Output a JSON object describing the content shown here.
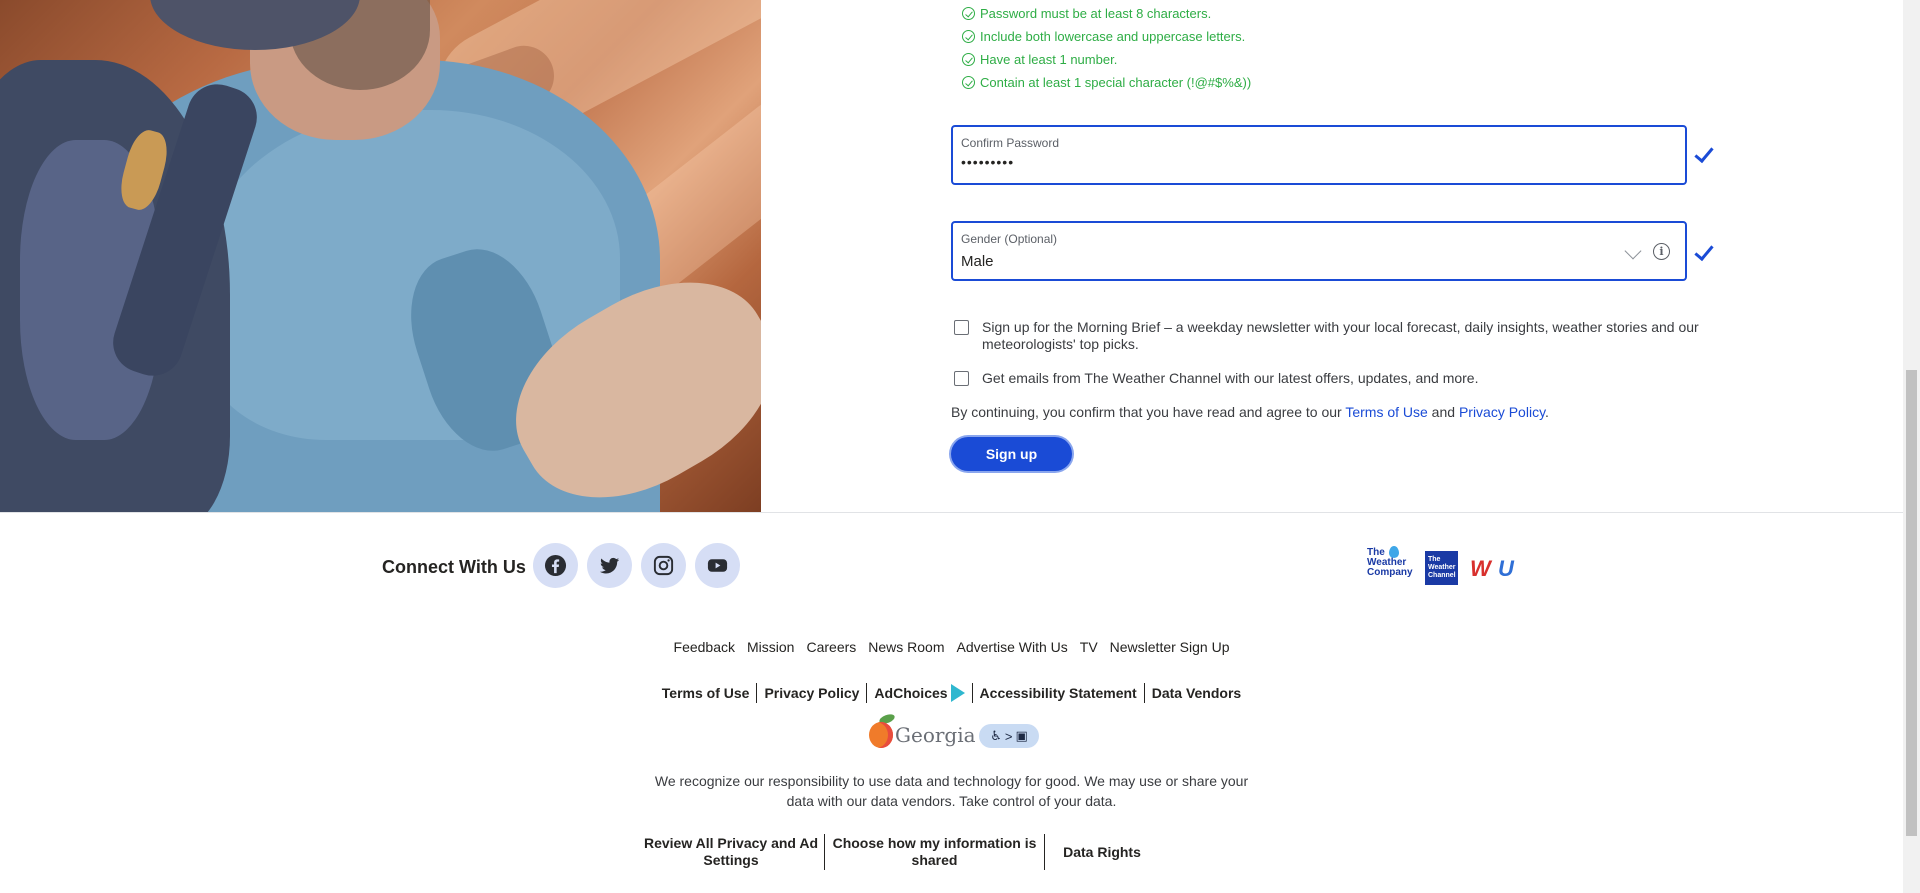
{
  "password_rules": [
    "Password must be at least 8 characters.",
    "Include both lowercase and uppercase letters.",
    "Have at least 1 number.",
    "Contain at least 1 special character (!@#$%&))"
  ],
  "confirm_password": {
    "label": "Confirm Password",
    "value": "•••••••••"
  },
  "gender": {
    "label": "Gender (Optional)",
    "value": "Male"
  },
  "checkboxes": {
    "morning_brief": "Sign up for the Morning Brief – a weekday newsletter with your local forecast, daily insights, weather stories and our meteorologists' top picks.",
    "emails": "Get emails from The Weather Channel with our latest offers, updates, and more."
  },
  "consent": {
    "prefix": "By continuing, you confirm that you have read and agree to our ",
    "terms": "Terms of Use",
    "and": " and ",
    "privacy": "Privacy Policy",
    "suffix": "."
  },
  "signup_button": "Sign up",
  "footer": {
    "connect": "Connect With Us",
    "social_icons": [
      "facebook-icon",
      "twitter-icon",
      "instagram-icon",
      "youtube-icon"
    ],
    "brands": {
      "weather_company": "The Weather Company",
      "weather_channel": "The Weather Channel",
      "wu_w": "W",
      "wu_u": "U"
    },
    "links_primary": [
      "Feedback",
      "Mission",
      "Careers",
      "News Room",
      "Advertise With Us",
      "TV",
      "Newsletter Sign Up"
    ],
    "links_secondary": [
      "Terms of Use",
      "Privacy Policy",
      "AdChoices",
      "Accessibility Statement",
      "Data Vendors"
    ],
    "georgia": "Georgia",
    "privacy_text_1": "We recognize our responsibility to use data and technology for good. We may use or share your",
    "privacy_text_2": "data with our data vendors. Take control of your data.",
    "privacy_links": [
      "Review All Privacy and Ad Settings",
      "Choose how my information is shared",
      "Data Rights"
    ]
  },
  "colors": {
    "accent": "#1a4bd6",
    "success": "#2ead45",
    "social_bg": "#d6def5"
  }
}
